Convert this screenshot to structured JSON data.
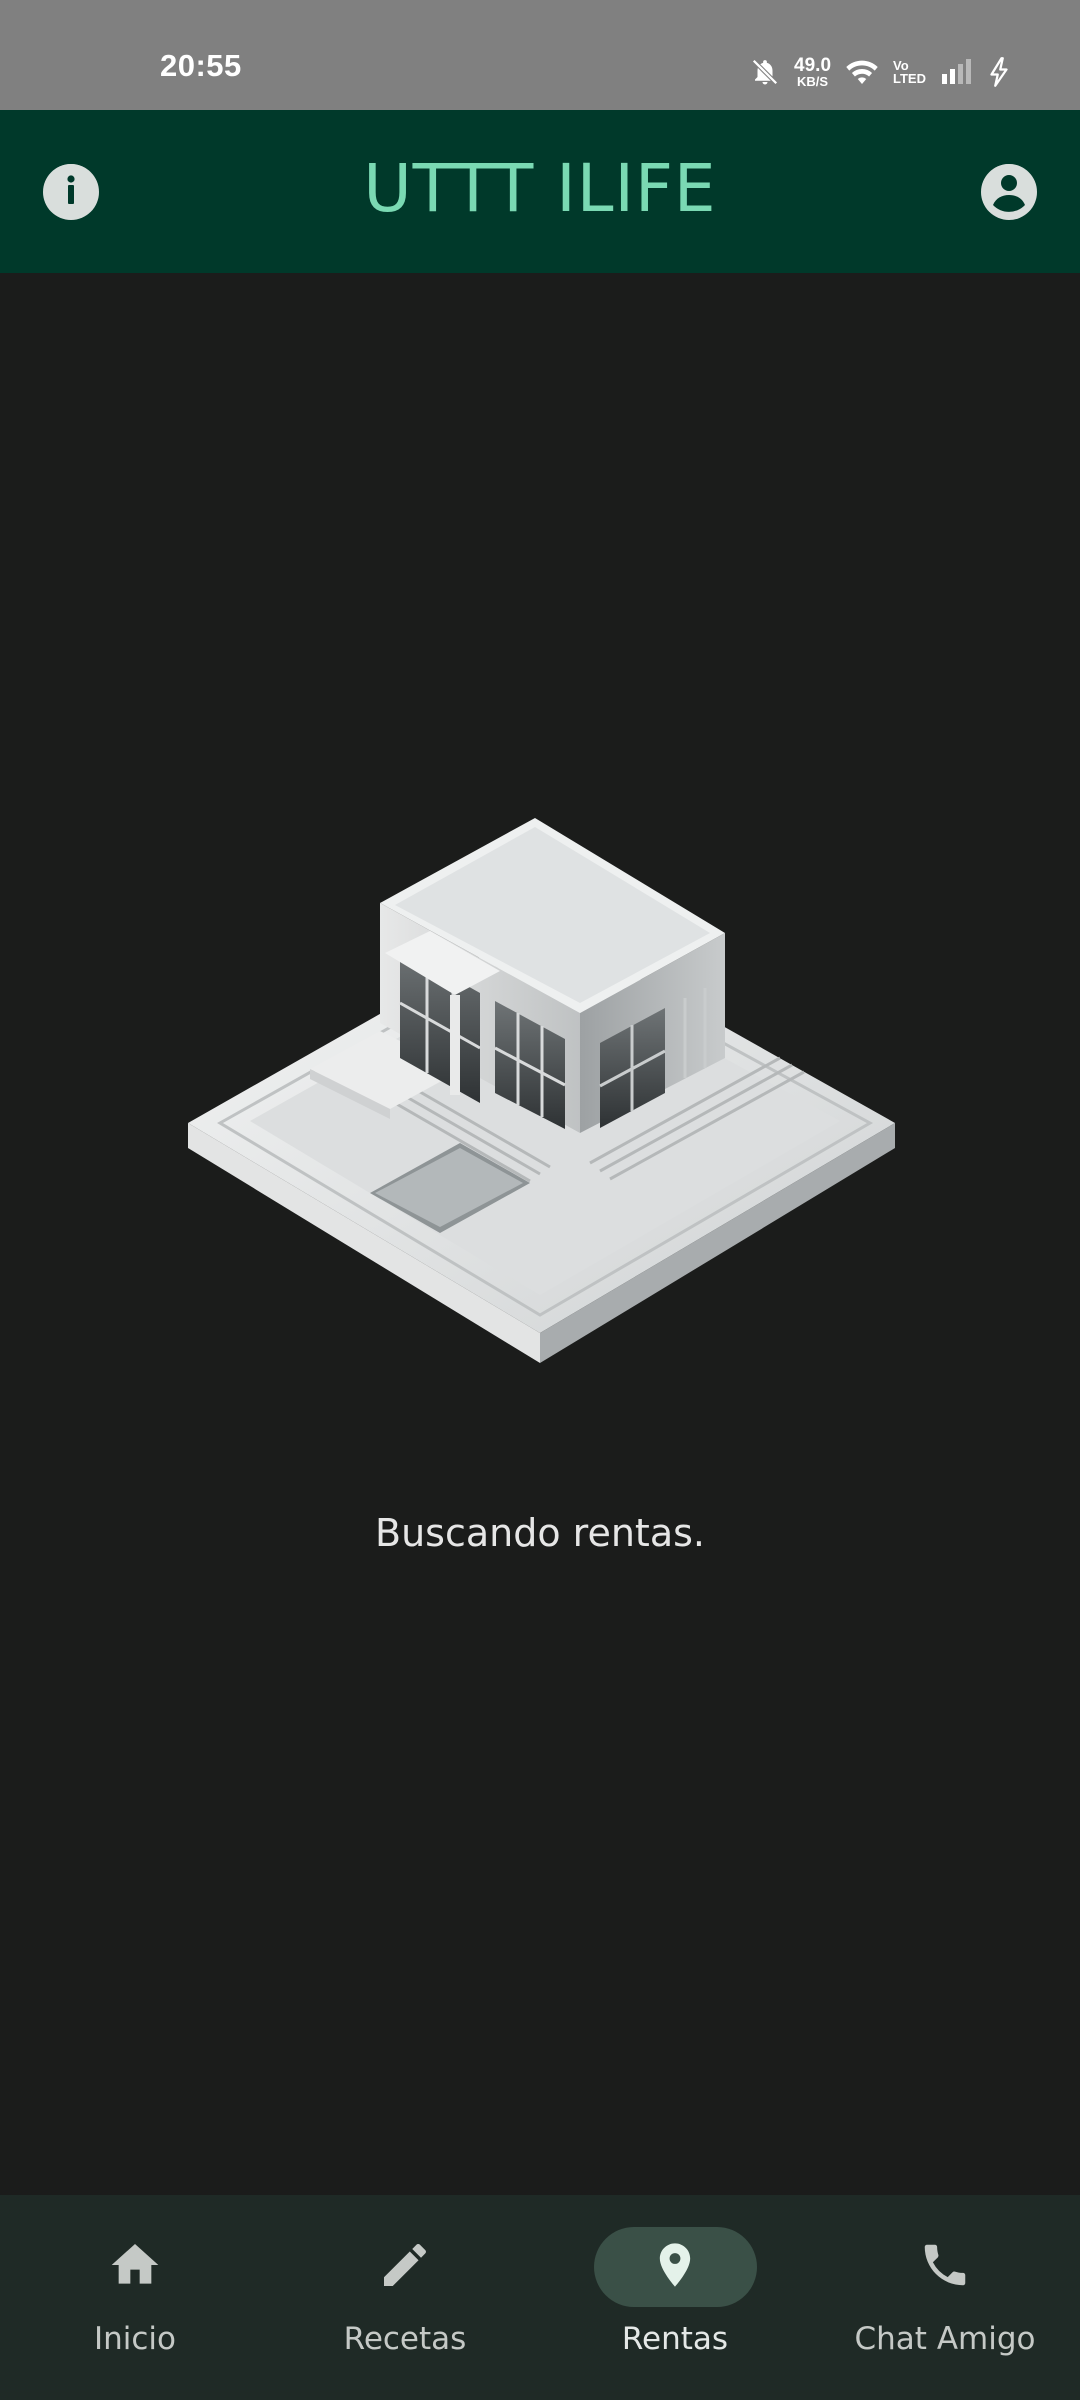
{
  "status_bar": {
    "time": "20:55",
    "net_speed_value": "49.0",
    "net_speed_unit": "KB/S",
    "volte_top": "Vo",
    "volte_bottom": "LTED",
    "icons": [
      "bell-off-icon",
      "wifi-icon",
      "signal-icon",
      "charging-icon"
    ]
  },
  "header": {
    "title": "UTTT ILIFE",
    "left_icon": "info-icon",
    "right_icon": "account-icon"
  },
  "main": {
    "illustration": "house-illustration",
    "status_text": "Buscando rentas."
  },
  "bottom_nav": {
    "items": [
      {
        "label": "Inicio",
        "icon": "home-icon",
        "active": false
      },
      {
        "label": "Recetas",
        "icon": "pencil-icon",
        "active": false
      },
      {
        "label": "Rentas",
        "icon": "location-pin-icon",
        "active": true
      },
      {
        "label": "Chat Amigo",
        "icon": "phone-icon",
        "active": false
      }
    ]
  },
  "colors": {
    "status_bar_bg": "#808080",
    "header_bg": "#00392a",
    "title_color": "#7ad9b3",
    "body_bg": "#1b1c1b",
    "nav_bg": "#1f2a26",
    "active_pill": "#3a5047"
  }
}
